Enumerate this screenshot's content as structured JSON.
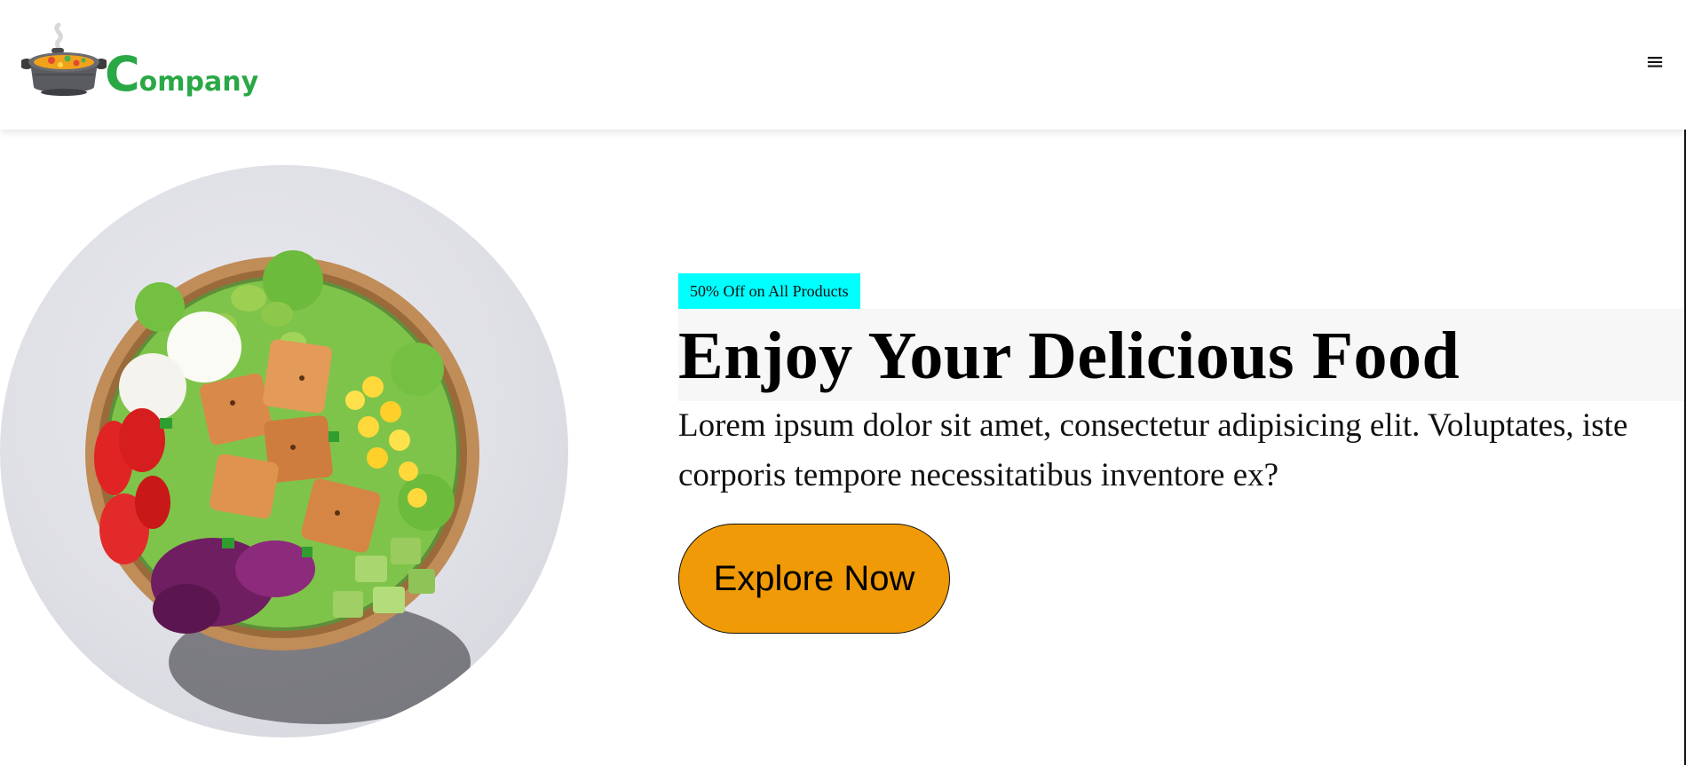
{
  "header": {
    "logo": {
      "initial": "C",
      "rest": "ompany",
      "icon": "cooking-pot-icon",
      "brand_color": "#2aa846"
    },
    "menu_icon": "hamburger-menu-icon",
    "menu_glyph": "≡"
  },
  "hero": {
    "image": "salad-bowl-image",
    "promo_badge": "50% Off on All Products",
    "title": "Enjoy Your Delicious Food",
    "description": "Lorem ipsum dolor sit amet, consectetur adipisicing elit. Voluptates, iste corporis tempore necessitatibus inventore ex?",
    "cta_label": "Explore Now",
    "colors": {
      "badge": "#00ffff",
      "cta": "#ef9a06"
    }
  }
}
